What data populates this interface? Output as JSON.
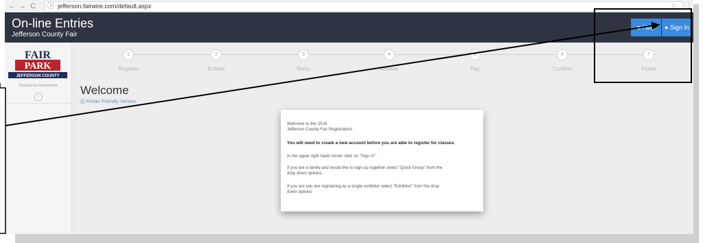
{
  "browser": {
    "back": "←",
    "forward": "→",
    "reload": "C",
    "info": "ⓘ",
    "url": "jefferson.fairwire.com/default.aspx",
    "star": "☆",
    "menu": "⋮"
  },
  "header": {
    "title": "On-line Entries",
    "subtitle": "Jefferson County Fair",
    "help_label": "Help",
    "signin_label": "Sign In",
    "bg_color": "#2e3441",
    "button_color": "#3a8be0"
  },
  "sidebar": {
    "logo_line1": "FAIR",
    "logo_line2": "PARK",
    "logo_band": "JEFFERSON COUNTY",
    "powered": "Powered by FrontierHost",
    "collapse_icon": "‹"
  },
  "steps": [
    {
      "num": "1",
      "label": "Register"
    },
    {
      "num": "2",
      "label": "Entries"
    },
    {
      "num": "3",
      "label": "Items"
    },
    {
      "num": "4",
      "label": "Review"
    },
    {
      "num": "5",
      "label": "Pay"
    },
    {
      "num": "6",
      "label": "Confirm"
    },
    {
      "num": "7",
      "label": "Finish"
    }
  ],
  "main": {
    "title": "Welcome",
    "printer_link": "Printer Friendly Version"
  },
  "card": {
    "line1": "Welcome to the 2018",
    "line2": "Jefferson County Fair Registration!",
    "bold": "You will need to create a new account before you are able to register for classes.",
    "p1": "In the upper right hand corner click on \"Sign In\".",
    "p2a": "If you are a family and would like to sign-up together select \"Quick Group\" from the",
    "p2b": "drop down options.",
    "p3a": "If you are you are registering as a single exhibitor select \"Exhibitor\" from the drop",
    "p3b": "down options"
  }
}
